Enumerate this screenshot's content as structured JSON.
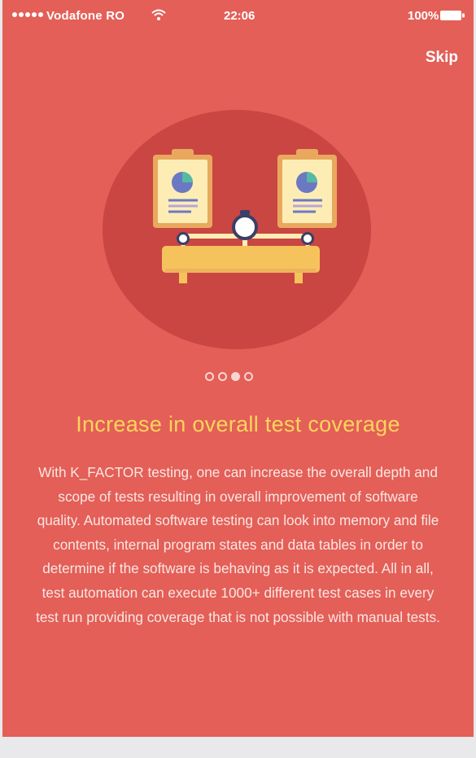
{
  "status_bar": {
    "carrier": "Vodafone RO",
    "time": "22:06",
    "battery": "100%",
    "icons": [
      "signal-dots-icon",
      "wifi-icon",
      "battery-icon"
    ]
  },
  "header": {
    "skip_label": "Skip"
  },
  "pager": {
    "count": 4,
    "active_index": 2
  },
  "content": {
    "title": "Increase in overall test coverage",
    "body": "With K_FACTOR testing, one can increase the overall depth and scope of tests resulting in overall improvement of software quality. Automated software testing can look into memory and file contents, internal program states and data tables in order to determine if the software is behaving as it is expected. All in all, test automation can execute 1000+ different test cases in every test run providing coverage that is not possible with manual tests."
  },
  "illustration": {
    "icon": "balance-scale-clipboards-icon"
  },
  "colors": {
    "background": "#e35f57",
    "circle": "#c94643",
    "title": "#fbd45c",
    "body_text": "#fbe6e3",
    "clipboard": "#fdedb5",
    "clip": "#e9a85e",
    "scale_base": "#f6c25c",
    "chart_blue": "#6b79c3",
    "chart_teal": "#55b9a4"
  }
}
